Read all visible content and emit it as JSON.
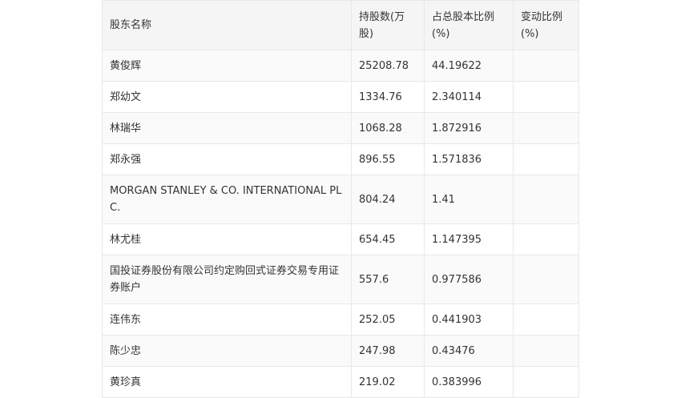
{
  "table": {
    "headers": [
      "股东名称",
      "持股数(万股)",
      "占总股本比例(%)",
      "变动比例(%)"
    ],
    "rows": [
      {
        "name": "黄俊辉",
        "shares": "25208.78",
        "ratio": "44.19622",
        "change": ""
      },
      {
        "name": "郑幼文",
        "shares": "1334.76",
        "ratio": "2.340114",
        "change": ""
      },
      {
        "name": "林瑞华",
        "shares": "1068.28",
        "ratio": "1.872916",
        "change": ""
      },
      {
        "name": "郑永强",
        "shares": "896.55",
        "ratio": "1.571836",
        "change": ""
      },
      {
        "name": "MORGAN STANLEY & CO. INTERNATIONAL PLC.",
        "shares": "804.24",
        "ratio": "1.41",
        "change": ""
      },
      {
        "name": "林尤桂",
        "shares": "654.45",
        "ratio": "1.147395",
        "change": ""
      },
      {
        "name": "国投证券股份有限公司约定购回式证券交易专用证券账户",
        "shares": "557.6",
        "ratio": "0.977586",
        "change": ""
      },
      {
        "name": "连伟东",
        "shares": "252.05",
        "ratio": "0.441903",
        "change": ""
      },
      {
        "name": "陈少忠",
        "shares": "247.98",
        "ratio": "0.43476",
        "change": ""
      },
      {
        "name": "黄珍真",
        "shares": "219.02",
        "ratio": "0.383996",
        "change": ""
      }
    ]
  }
}
